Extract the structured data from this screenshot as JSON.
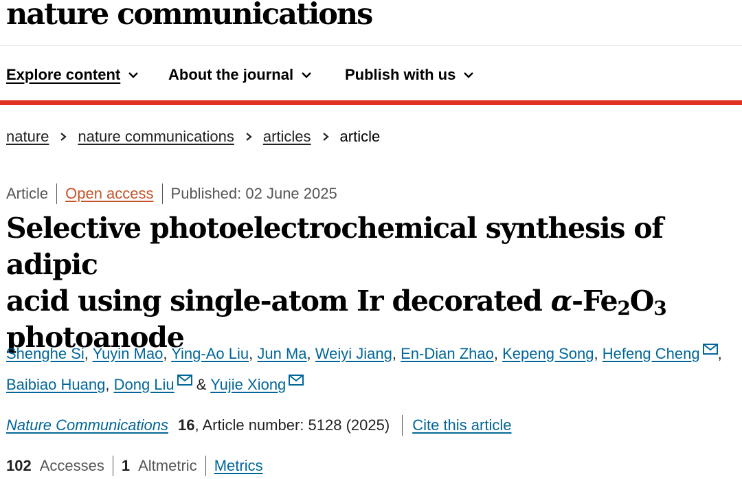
{
  "site": {
    "logo": "nature communications"
  },
  "nav": {
    "items": [
      {
        "label": "Explore content",
        "active": true
      },
      {
        "label": "About the journal",
        "active": false
      },
      {
        "label": "Publish with us",
        "active": false
      }
    ],
    "accent_color": "#e0301e"
  },
  "breadcrumb": {
    "items": [
      "nature",
      "nature communications",
      "articles"
    ],
    "current": "article"
  },
  "article": {
    "type": "Article",
    "access": "Open access",
    "published": "Published: 02 June 2025",
    "title": {
      "line1": "Selective photoelectrochemical synthesis of adipic",
      "line2_part1": "acid using single-atom Ir decorated ",
      "alpha": "α",
      "fe": "-Fe",
      "fe_sub": "2",
      "o": "O",
      "o_sub": "3",
      "line3": "photoanode"
    },
    "authors": [
      {
        "name": "Shenghe Si",
        "email": false
      },
      {
        "name": "Yuyin Mao",
        "email": false
      },
      {
        "name": "Ying-Ao Liu",
        "email": false
      },
      {
        "name": "Jun Ma",
        "email": false
      },
      {
        "name": "Weiyi Jiang",
        "email": false
      },
      {
        "name": "En-Dian Zhao",
        "email": false
      },
      {
        "name": "Kepeng Song",
        "email": false
      },
      {
        "name": "Hefeng Cheng",
        "email": true
      },
      {
        "name": "Baibiao Huang",
        "email": false
      },
      {
        "name": "Dong Liu",
        "email": true
      },
      {
        "name": "Yujie Xiong",
        "email": true
      }
    ],
    "author_separator": ",",
    "author_last_joiner": "&",
    "citation": {
      "journal": "Nature Communications",
      "volume": "16",
      "article_number": ", Article number: 5128 (2025)",
      "cite_link": "Cite this article"
    },
    "metrics": {
      "accesses_count": "102",
      "accesses_label": "Accesses",
      "altmetric_count": "1",
      "altmetric_label": "Altmetric",
      "metrics_link": "Metrics"
    }
  },
  "colors": {
    "link": "#006699",
    "open_access": "#c4532a",
    "text": "#222222"
  },
  "icons": {
    "nav_chevron": "chevron-down-icon",
    "breadcrumb_sep": "chevron-right-icon",
    "email": "envelope-icon"
  }
}
